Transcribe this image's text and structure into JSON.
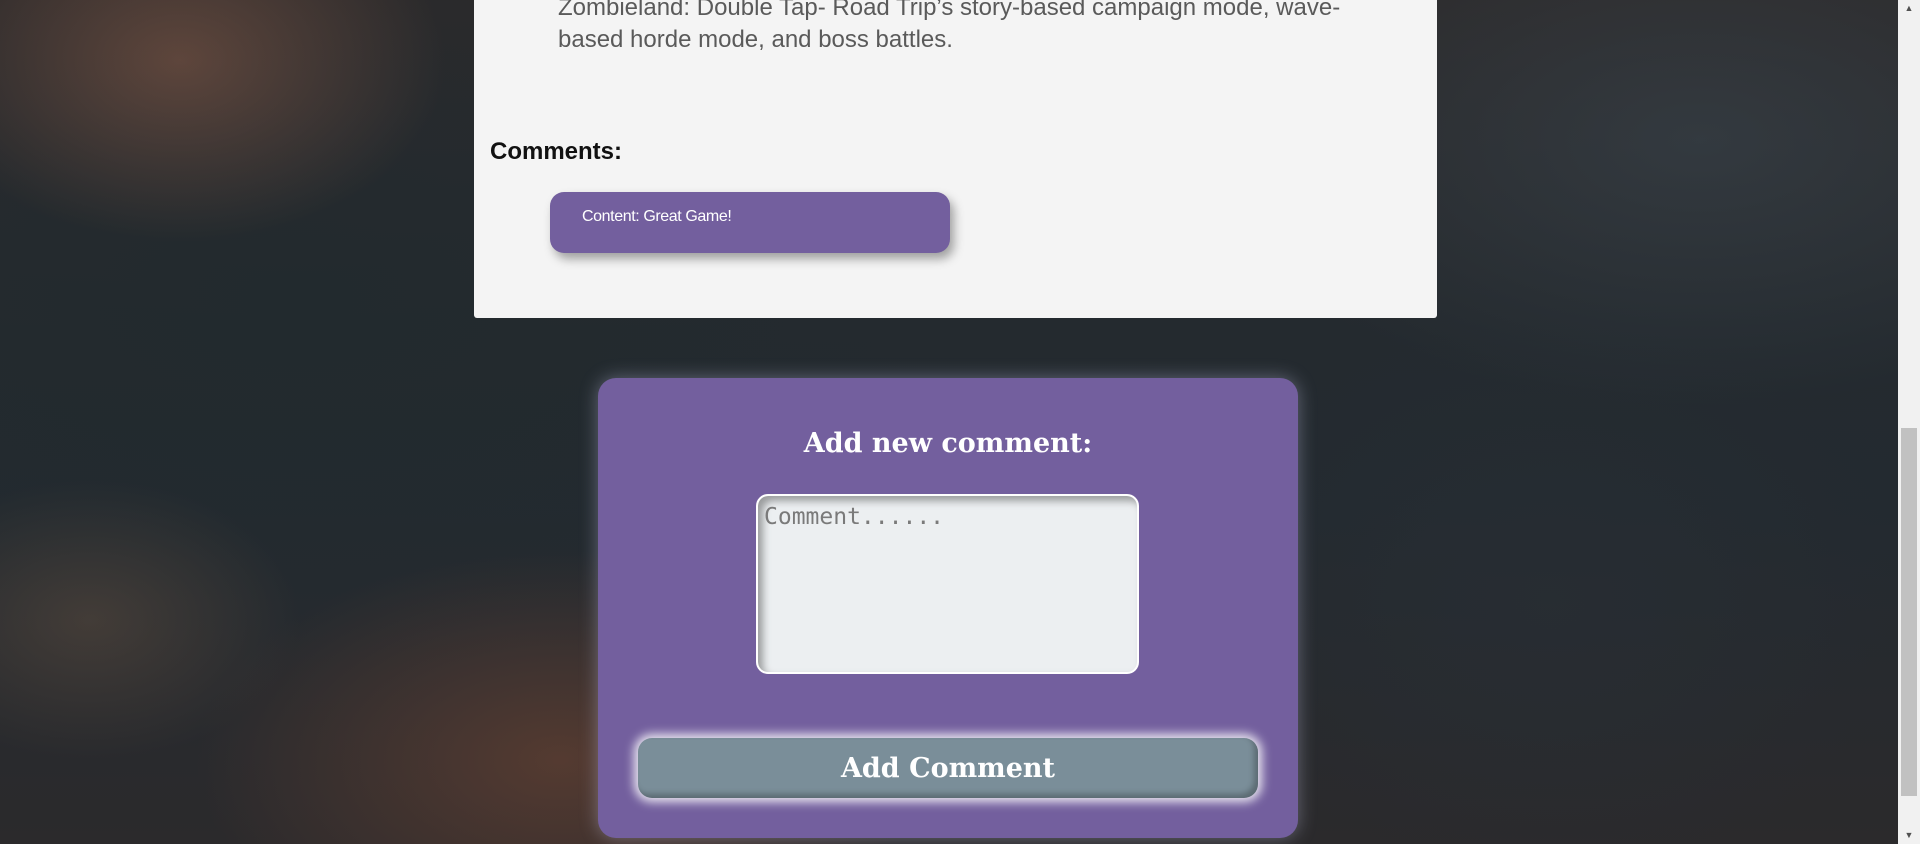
{
  "article": {
    "description": "Zombieland: Double Tap- Road Trip’s story-based campaign mode, wave-based horde mode, and boss battles."
  },
  "comments": {
    "heading": "Comments:",
    "items": [
      {
        "text": "Content: Great Game!"
      }
    ]
  },
  "new_comment_form": {
    "title": "Add new comment:",
    "placeholder": "Comment......",
    "submit_label": "Add Comment"
  },
  "scrollbar": {
    "up_icon": "triangle-up-icon",
    "down_icon": "triangle-down-icon",
    "position": 0.95
  },
  "colors": {
    "accent_purple": "#735f9e",
    "button_gray": "#7a8e99",
    "card_background": "#f4f4f4"
  }
}
